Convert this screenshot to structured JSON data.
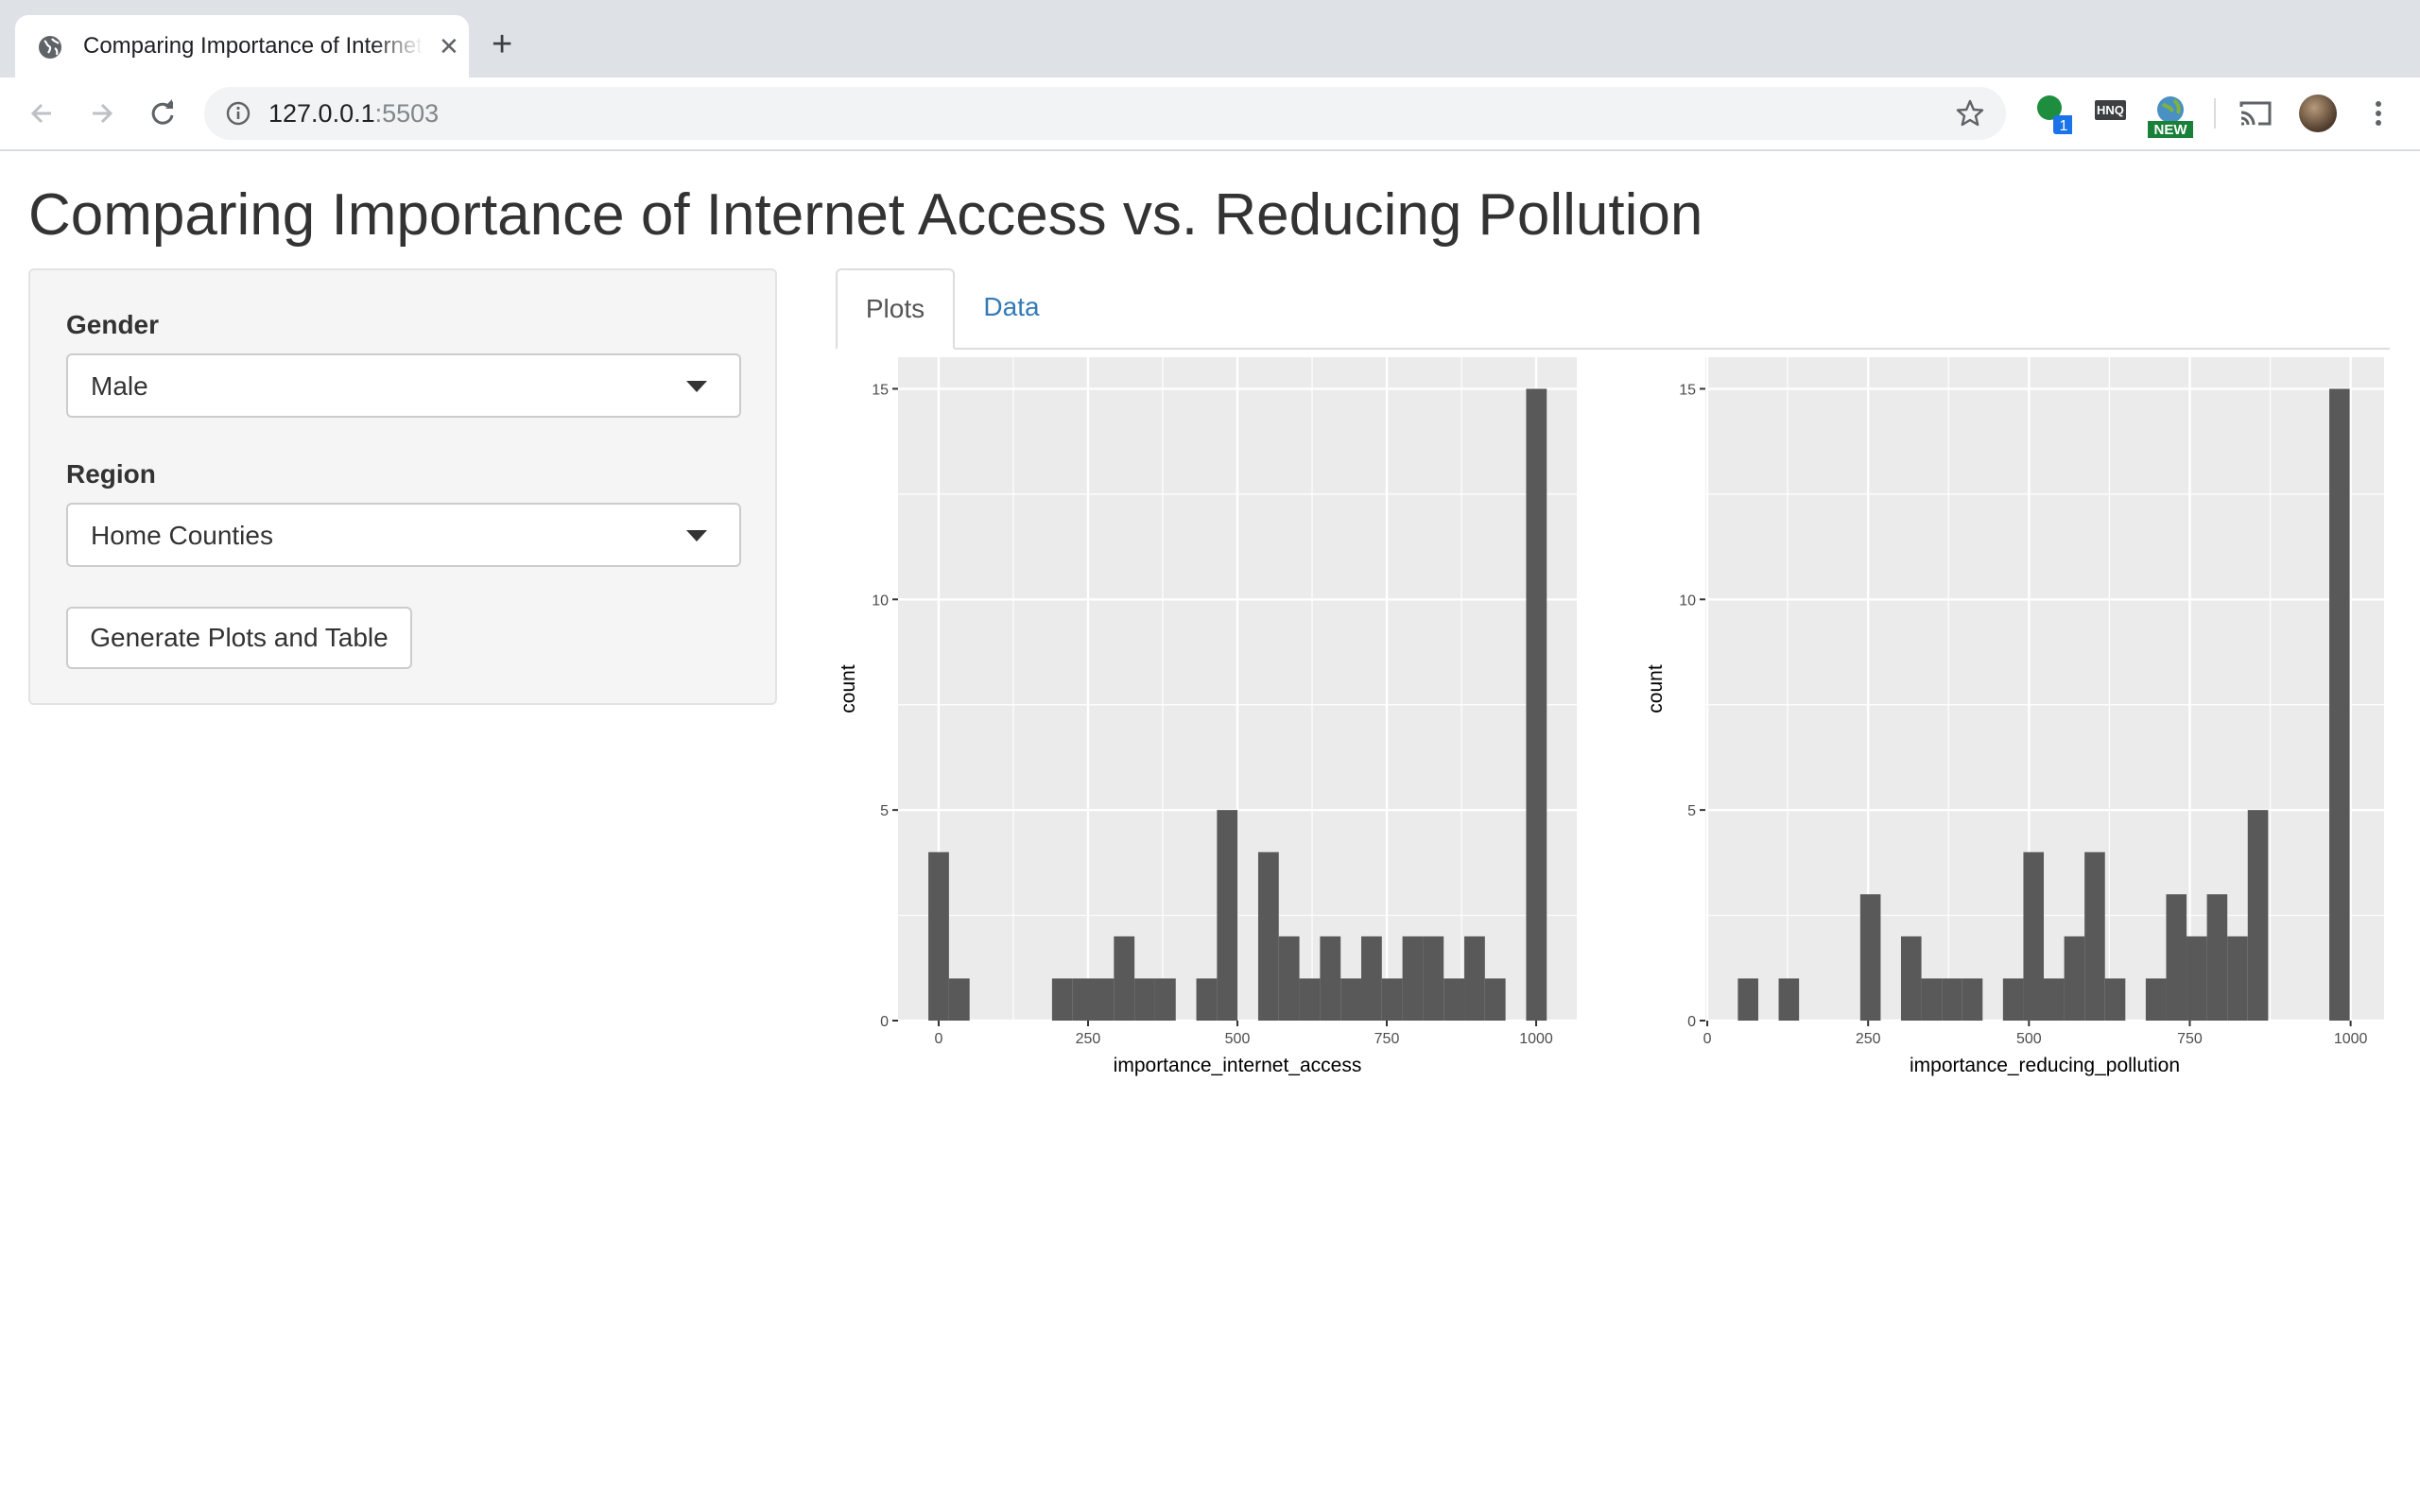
{
  "browser": {
    "tab_title": "Comparing Importance of Internet Access vs. Reducing Pollution",
    "url_host": "127.0.0.1",
    "url_port": ":5503",
    "extension_badge": "1",
    "extension_new_label": "NEW",
    "hnq_label": "HNQ"
  },
  "app": {
    "title": "Comparing Importance of Internet Access vs. Reducing Pollution",
    "gender_label": "Gender",
    "gender_value": "Male",
    "region_label": "Region",
    "region_value": "Home Counties",
    "generate_button": "Generate Plots and Table",
    "tabs": [
      {
        "label": "Plots",
        "active": true
      },
      {
        "label": "Data",
        "active": false
      }
    ]
  },
  "colors": {
    "panel_bg": "#ebebeb",
    "bar_fill": "#595959",
    "link": "#337ab7"
  },
  "chart_data": [
    {
      "type": "bar",
      "xlabel": "importance_internet_access",
      "ylabel": "count",
      "x_ticks": [
        0,
        250,
        500,
        750,
        1000
      ],
      "y_ticks": [
        0,
        5,
        10,
        15
      ],
      "xlim": [
        -68,
        1068
      ],
      "ylim": [
        0,
        15.75
      ],
      "bin_width": 34.5,
      "bins": [
        {
          "x": 0,
          "count": 4
        },
        {
          "x": 34.5,
          "count": 1
        },
        {
          "x": 69,
          "count": 0
        },
        {
          "x": 103.5,
          "count": 0
        },
        {
          "x": 138,
          "count": 0
        },
        {
          "x": 172.5,
          "count": 0
        },
        {
          "x": 207,
          "count": 1
        },
        {
          "x": 241.5,
          "count": 1
        },
        {
          "x": 276,
          "count": 1
        },
        {
          "x": 310.5,
          "count": 2
        },
        {
          "x": 345,
          "count": 1
        },
        {
          "x": 379.5,
          "count": 1
        },
        {
          "x": 414,
          "count": 0
        },
        {
          "x": 448.5,
          "count": 1
        },
        {
          "x": 483,
          "count": 5
        },
        {
          "x": 517.5,
          "count": 0
        },
        {
          "x": 552,
          "count": 4
        },
        {
          "x": 586.5,
          "count": 2
        },
        {
          "x": 621,
          "count": 1
        },
        {
          "x": 655.5,
          "count": 2
        },
        {
          "x": 690,
          "count": 1
        },
        {
          "x": 724.5,
          "count": 2
        },
        {
          "x": 759,
          "count": 1
        },
        {
          "x": 793.5,
          "count": 2
        },
        {
          "x": 828,
          "count": 2
        },
        {
          "x": 862.5,
          "count": 1
        },
        {
          "x": 897,
          "count": 2
        },
        {
          "x": 931.5,
          "count": 1
        },
        {
          "x": 966,
          "count": 0
        },
        {
          "x": 1000.5,
          "count": 15
        }
      ]
    },
    {
      "type": "bar",
      "xlabel": "importance_reducing_pollution",
      "ylabel": "count",
      "x_ticks": [
        0,
        250,
        500,
        750,
        1000
      ],
      "y_ticks": [
        0,
        5,
        10,
        15
      ],
      "xlim": [
        -3,
        1052
      ],
      "ylim": [
        0,
        15.75
      ],
      "bin_width": 31.7,
      "bins": [
        {
          "x": 63.4,
          "count": 1
        },
        {
          "x": 95.1,
          "count": 0
        },
        {
          "x": 126.8,
          "count": 1
        },
        {
          "x": 158.5,
          "count": 0
        },
        {
          "x": 190.2,
          "count": 0
        },
        {
          "x": 221.9,
          "count": 0
        },
        {
          "x": 253.6,
          "count": 3
        },
        {
          "x": 285.3,
          "count": 0
        },
        {
          "x": 317,
          "count": 2
        },
        {
          "x": 348.7,
          "count": 1
        },
        {
          "x": 380.4,
          "count": 1
        },
        {
          "x": 412.1,
          "count": 1
        },
        {
          "x": 443.8,
          "count": 0
        },
        {
          "x": 475.5,
          "count": 1
        },
        {
          "x": 507.2,
          "count": 4
        },
        {
          "x": 538.9,
          "count": 1
        },
        {
          "x": 570.6,
          "count": 2
        },
        {
          "x": 602.3,
          "count": 4
        },
        {
          "x": 634,
          "count": 1
        },
        {
          "x": 665.7,
          "count": 0
        },
        {
          "x": 697.4,
          "count": 1
        },
        {
          "x": 729.1,
          "count": 3
        },
        {
          "x": 760.8,
          "count": 2
        },
        {
          "x": 792.5,
          "count": 3
        },
        {
          "x": 824.2,
          "count": 2
        },
        {
          "x": 855.9,
          "count": 5
        },
        {
          "x": 887.6,
          "count": 0
        },
        {
          "x": 919.3,
          "count": 0
        },
        {
          "x": 951,
          "count": 0
        },
        {
          "x": 982.7,
          "count": 15
        }
      ]
    }
  ]
}
